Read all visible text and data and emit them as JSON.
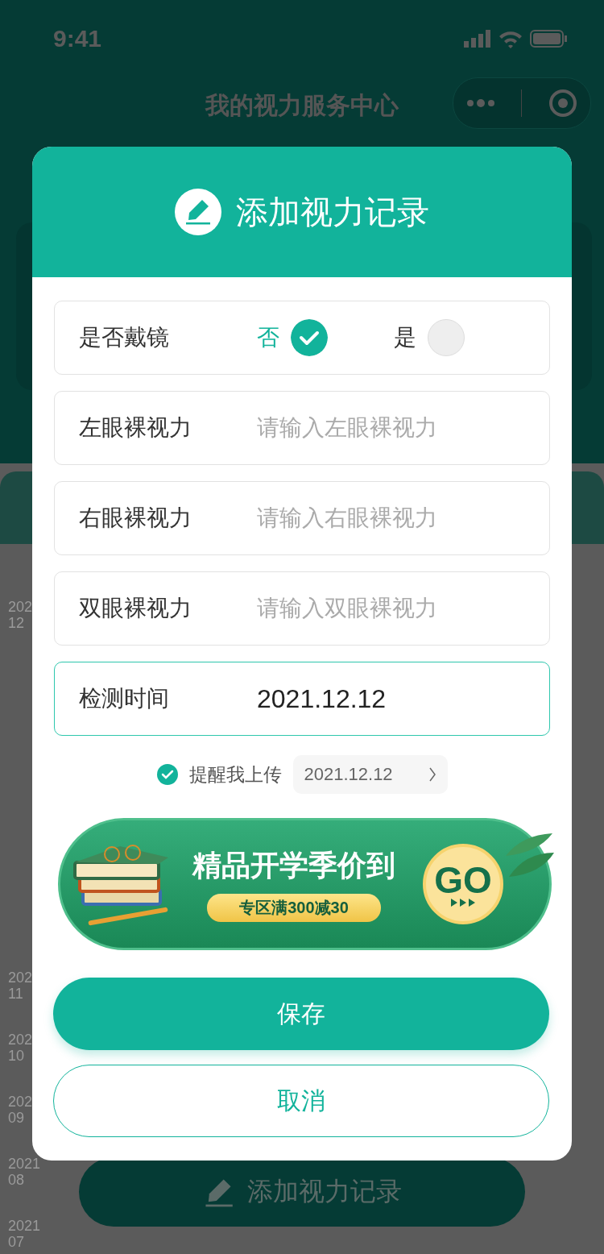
{
  "status_bar": {
    "time": "9:41"
  },
  "nav_bar": {
    "title": "我的视力服务中心"
  },
  "timeline": [
    {
      "year": "202",
      "month": "12"
    },
    {
      "year": "202",
      "month": "11"
    },
    {
      "year": "202",
      "month": "10"
    },
    {
      "year": "202",
      "month": "09"
    },
    {
      "year": "2021",
      "month": "08"
    },
    {
      "year": "2021",
      "month": "07"
    }
  ],
  "add_button": {
    "label": "添加视力记录"
  },
  "dialog": {
    "title": "添加视力记录",
    "glasses": {
      "label": "是否戴镜",
      "options": [
        {
          "label": "否",
          "selected": true
        },
        {
          "label": "是",
          "selected": false
        }
      ]
    },
    "fields": [
      {
        "label": "左眼裸视力",
        "placeholder": "请输入左眼裸视力",
        "focused": false
      },
      {
        "label": "右眼裸视力",
        "placeholder": "请输入右眼裸视力",
        "focused": false
      },
      {
        "label": "双眼裸视力",
        "placeholder": "请输入双眼裸视力",
        "focused": false
      },
      {
        "label": "检测时间",
        "value": "2021.12.12",
        "focused": true
      }
    ],
    "reminder": {
      "checked": true,
      "label": "提醒我上传",
      "date": "2021.12.12"
    },
    "banner": {
      "title": "精品开学季价到",
      "subtitle": "专区满300减30",
      "cta": "GO"
    },
    "buttons": [
      {
        "label": "保存",
        "kind": "primary"
      },
      {
        "label": "取消",
        "kind": "secondary"
      }
    ]
  }
}
